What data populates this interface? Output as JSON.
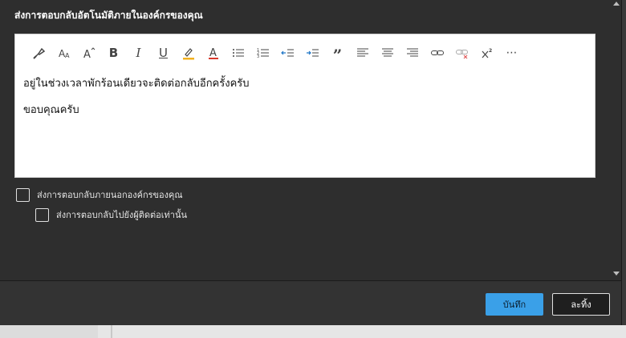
{
  "dialog": {
    "title": "ส่งการตอบกลับอัตโนมัติภายในองค์กรของคุณ"
  },
  "toolbar": {
    "items": [
      {
        "name": "format-painter-icon"
      },
      {
        "name": "font-size-icon"
      },
      {
        "name": "increase-font-size-icon"
      },
      {
        "name": "bold-icon",
        "glyph": "B"
      },
      {
        "name": "italic-icon",
        "glyph": "I"
      },
      {
        "name": "underline-icon",
        "glyph": "U"
      },
      {
        "name": "highlight-icon"
      },
      {
        "name": "font-color-icon",
        "glyph": "A"
      },
      {
        "name": "bullets-icon"
      },
      {
        "name": "numbering-icon"
      },
      {
        "name": "decrease-indent-icon"
      },
      {
        "name": "increase-indent-icon"
      },
      {
        "name": "quote-icon",
        "glyph": "”"
      },
      {
        "name": "align-left-icon"
      },
      {
        "name": "align-center-icon"
      },
      {
        "name": "align-right-icon"
      },
      {
        "name": "link-icon"
      },
      {
        "name": "unlink-icon"
      },
      {
        "name": "superscript-icon"
      },
      {
        "name": "more-icon",
        "glyph": "⋯"
      }
    ],
    "colors": {
      "highlight": "#f2b01e",
      "font_color": "#d9382b",
      "indent_arrow": "#1f76c7",
      "unlink_x": "#e05a5a"
    }
  },
  "editor": {
    "line1": "อยู่ในช่วงเวลาพักร้อนเดียวจะติดต่อกลับอีกครั้งครับ",
    "line2": "ขอบคุณครับ"
  },
  "options": {
    "external_label": "ส่งการตอบกลับภายนอกองค์กรของคุณ",
    "contacts_only_label": "ส่งการตอบกลับไปยังผู้ติดต่อเท่านั้น"
  },
  "buttons": {
    "save": "บันทึก",
    "discard": "ละทิ้ง"
  },
  "colors": {
    "accent": "#3aa0e8",
    "dialog_bg": "#2e2e2e"
  }
}
